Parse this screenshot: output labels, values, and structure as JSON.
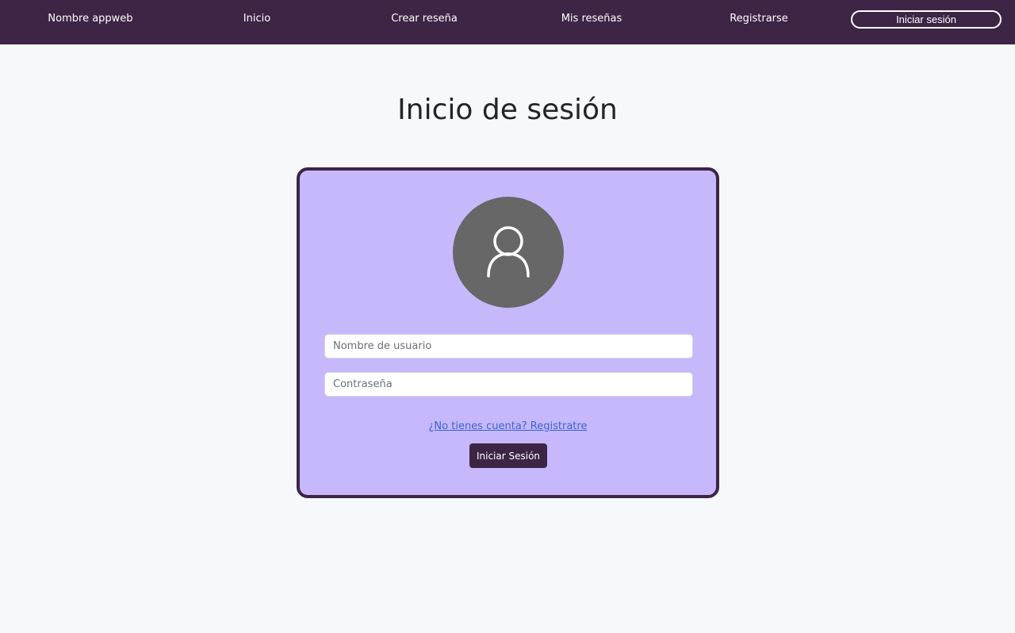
{
  "nav": {
    "brand": "Nombre appweb",
    "items": [
      {
        "label": "Inicio"
      },
      {
        "label": "Crear reseña"
      },
      {
        "label": "Mis reseñas"
      },
      {
        "label": "Registrarse"
      }
    ],
    "login_button": "Iniciar sesión"
  },
  "page": {
    "title": "Inicio de sesión"
  },
  "form": {
    "avatar_icon": "user-icon",
    "username_placeholder": "Nombre de usuario",
    "password_placeholder": "Contraseña",
    "register_link": "¿No tienes cuenta? Registratre",
    "submit_label": "Iniciar Sesión"
  },
  "colors": {
    "navbar": "#3d2546",
    "card": "#c7b8fb",
    "avatar": "#676767",
    "link": "#3a63d3"
  }
}
